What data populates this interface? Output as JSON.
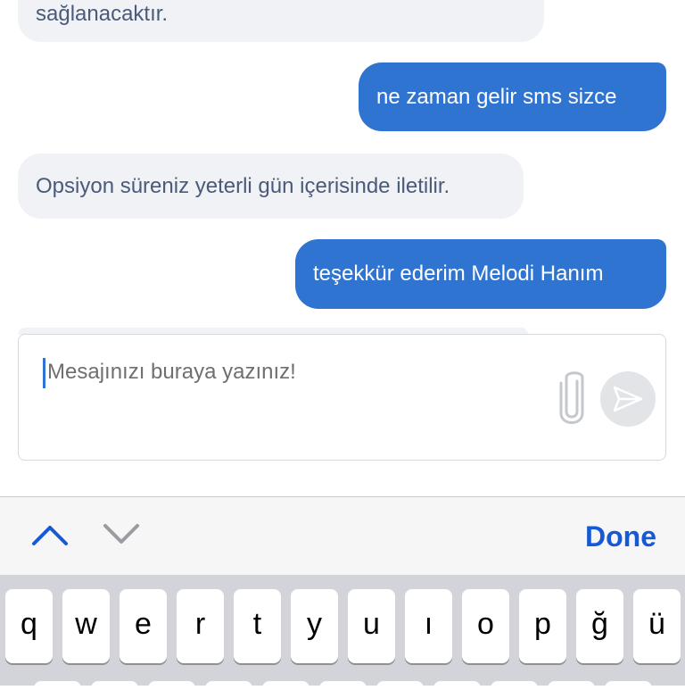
{
  "chat": {
    "messages": [
      {
        "side": "incoming",
        "text": "sağlanacaktır."
      },
      {
        "side": "outgoing",
        "text": "ne zaman gelir sms sizce"
      },
      {
        "side": "incoming",
        "text": "Opsiyon süreniz yeterli gün içerisinde iletilir."
      },
      {
        "side": "outgoing",
        "text": "teşekkür ederim Melodi Hanım"
      }
    ]
  },
  "composer": {
    "placeholder": "Mesajınızı buraya yazınız!",
    "attach_icon": "paperclip-icon",
    "send_icon": "send-icon"
  },
  "keyboard_toolbar": {
    "done_label": "Done",
    "prev_icon": "chevron-up-icon",
    "next_icon": "chevron-down-icon"
  },
  "keyboard": {
    "row1": [
      "q",
      "w",
      "e",
      "r",
      "t",
      "y",
      "u",
      "ı",
      "o",
      "p",
      "ğ",
      "ü"
    ]
  },
  "colors": {
    "outgoing_bubble": "#2f74d0",
    "incoming_bubble": "#f0f2f6",
    "incoming_text": "#4a5a7a",
    "done": "#1658d6"
  }
}
